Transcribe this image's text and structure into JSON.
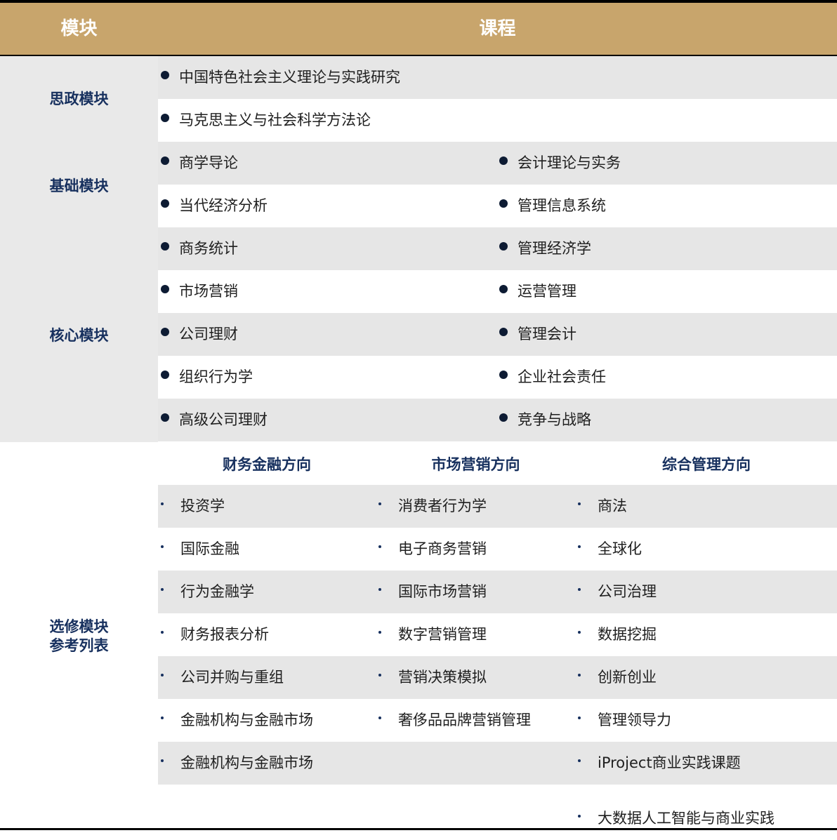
{
  "header": {
    "module_label": "模块",
    "course_label": "课程"
  },
  "modules": {
    "sizheng": "思政模块",
    "jichu": "基础模块",
    "hexin": "核心模块",
    "elective_line1": "选修模块",
    "elective_line2": "参考列表"
  },
  "required_rows": [
    {
      "left": "中国特色社会主义理论与实践研究",
      "right": ""
    },
    {
      "left": "马克思主义与社会科学方法论",
      "right": ""
    },
    {
      "left": "商学导论",
      "right": "会计理论与实务"
    },
    {
      "left": "当代经济分析",
      "right": "管理信息系统"
    },
    {
      "left": "商务统计",
      "right": "管理经济学"
    },
    {
      "left": "市场营销",
      "right": "运营管理"
    },
    {
      "left": "公司理财",
      "right": "管理会计"
    },
    {
      "left": "组织行为学",
      "right": "企业社会责任"
    },
    {
      "left": "高级公司理财",
      "right": "竞争与战略"
    }
  ],
  "elective": {
    "columns": [
      "财务金融方向",
      "市场营销方向",
      "综合管理方向"
    ],
    "rows": [
      [
        "投资学",
        "消费者行为学",
        "商法"
      ],
      [
        "国际金融",
        "电子商务营销",
        "全球化"
      ],
      [
        "行为金融学",
        "国际市场营销",
        "公司治理"
      ],
      [
        "财务报表分析",
        "数字营销管理",
        "数据挖掘"
      ],
      [
        "公司并购与重组",
        "营销决策模拟",
        "创新创业"
      ],
      [
        "金融机构与金融市场",
        "奢侈品品牌营销管理",
        "管理领导力"
      ],
      [
        "金融机构与金融市场",
        "",
        "iProject商业实践课题"
      ]
    ],
    "extra_item": "大数据人工智能与商业实践"
  },
  "colors": {
    "header_bg": "#c8a56c",
    "accent_text": "#17305e",
    "row_gray": "#e6e6e6"
  }
}
